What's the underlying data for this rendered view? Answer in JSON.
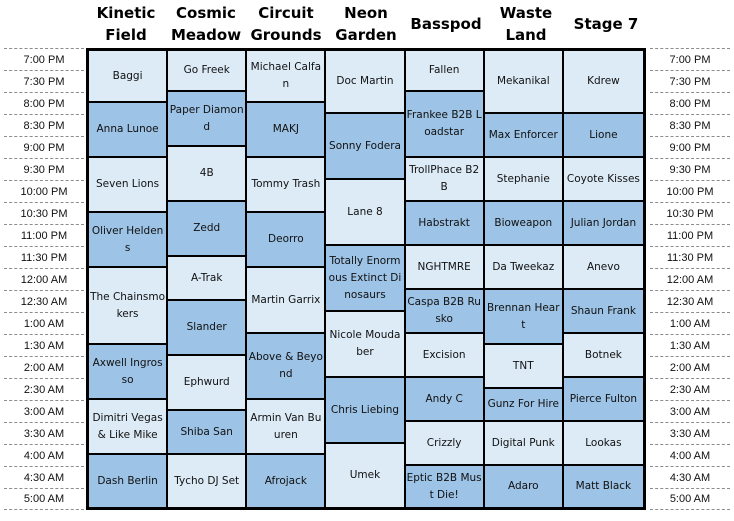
{
  "stages": [
    {
      "name": "Kinetic Field",
      "sets": [
        {
          "artist": "Baggi",
          "slots": 5,
          "shade": "light"
        },
        {
          "artist": "Anna Lunoe",
          "slots": 5,
          "shade": "dark"
        },
        {
          "artist": "Seven Lions",
          "slots": 5,
          "shade": "light"
        },
        {
          "artist": "Oliver Heldens",
          "slots": 5,
          "shade": "dark"
        },
        {
          "artist": "The Chainsmokers",
          "slots": 7,
          "shade": "light"
        },
        {
          "artist": "Axwell Ingrosso",
          "slots": 5,
          "shade": "dark"
        },
        {
          "artist": "Dimitri Vegas & Like Mike",
          "slots": 5,
          "shade": "light"
        },
        {
          "artist": "Dash Berlin",
          "slots": 5,
          "shade": "dark"
        }
      ]
    },
    {
      "name": "Cosmic Meadow",
      "sets": [
        {
          "artist": "Go Freek",
          "slots": 4,
          "shade": "light"
        },
        {
          "artist": "Paper Diamond",
          "slots": 5,
          "shade": "dark"
        },
        {
          "artist": "4B",
          "slots": 5,
          "shade": "light"
        },
        {
          "artist": "Zedd",
          "slots": 5,
          "shade": "dark"
        },
        {
          "artist": "A-Trak",
          "slots": 4,
          "shade": "light"
        },
        {
          "artist": "Slander",
          "slots": 5,
          "shade": "dark"
        },
        {
          "artist": "Ephwurd",
          "slots": 5,
          "shade": "light"
        },
        {
          "artist": "Shiba San",
          "slots": 4,
          "shade": "dark"
        },
        {
          "artist": "Tycho DJ Set",
          "slots": 5,
          "shade": "light"
        }
      ]
    },
    {
      "name": "Circuit Grounds",
      "sets": [
        {
          "artist": "Michael Calfan",
          "slots": 5,
          "shade": "light"
        },
        {
          "artist": "MAKJ",
          "slots": 5,
          "shade": "dark"
        },
        {
          "artist": "Tommy Trash",
          "slots": 5,
          "shade": "light"
        },
        {
          "artist": "Deorro",
          "slots": 5,
          "shade": "dark"
        },
        {
          "artist": "Martin Garrix",
          "slots": 6,
          "shade": "light"
        },
        {
          "artist": "Above & Beyond",
          "slots": 6,
          "shade": "dark"
        },
        {
          "artist": "Armin Van Buuren",
          "slots": 5,
          "shade": "light"
        },
        {
          "artist": "Afrojack",
          "slots": 5,
          "shade": "dark"
        }
      ]
    },
    {
      "name": "Neon Garden",
      "sets": [
        {
          "artist": "Doc Martin",
          "slots": 6,
          "shade": "light"
        },
        {
          "artist": "Sonny Fodera",
          "slots": 6,
          "shade": "dark"
        },
        {
          "artist": "Lane 8",
          "slots": 6,
          "shade": "light"
        },
        {
          "artist": "Totally Enormous Extinct Dinosaurs",
          "slots": 6,
          "shade": "dark"
        },
        {
          "artist": "Nicole Moudaber",
          "slots": 6,
          "shade": "light"
        },
        {
          "artist": "Chris Liebing",
          "slots": 6,
          "shade": "dark"
        },
        {
          "artist": "Umek",
          "slots": 6,
          "shade": "light"
        }
      ]
    },
    {
      "name": "Basspod",
      "sets": [
        {
          "artist": "Fallen",
          "slots": 4,
          "shade": "light"
        },
        {
          "artist": "Frankee B2B Loadstar",
          "slots": 6,
          "shade": "dark"
        },
        {
          "artist": "TrollPhace B2B",
          "slots": 4,
          "shade": "light"
        },
        {
          "artist": "Habstrakt",
          "slots": 4,
          "shade": "dark"
        },
        {
          "artist": "NGHTMRE",
          "slots": 4,
          "shade": "light"
        },
        {
          "artist": "Caspa B2B Rusko",
          "slots": 4,
          "shade": "dark"
        },
        {
          "artist": "Excision",
          "slots": 4,
          "shade": "light"
        },
        {
          "artist": "Andy C",
          "slots": 4,
          "shade": "dark"
        },
        {
          "artist": "Crizzly",
          "slots": 4,
          "shade": "light"
        },
        {
          "artist": "Eptic B2B Must Die!",
          "slots": 4,
          "shade": "dark"
        }
      ]
    },
    {
      "name": "Waste Land",
      "sets": [
        {
          "artist": "Mekanikal",
          "slots": 6,
          "shade": "light"
        },
        {
          "artist": "Max Enforcer",
          "slots": 4,
          "shade": "dark"
        },
        {
          "artist": "Stephanie",
          "slots": 4,
          "shade": "light"
        },
        {
          "artist": "Bioweapon",
          "slots": 4,
          "shade": "dark"
        },
        {
          "artist": "Da Tweekaz",
          "slots": 4,
          "shade": "light"
        },
        {
          "artist": "Brennan Heart",
          "slots": 5,
          "shade": "dark"
        },
        {
          "artist": "TNT",
          "slots": 4,
          "shade": "light"
        },
        {
          "artist": "Gunz For Hire",
          "slots": 3,
          "shade": "dark"
        },
        {
          "artist": "Digital Punk",
          "slots": 4,
          "shade": "light"
        },
        {
          "artist": "Adaro",
          "slots": 4,
          "shade": "dark"
        }
      ]
    },
    {
      "name": "Stage 7",
      "sets": [
        {
          "artist": "Kdrew",
          "slots": 6,
          "shade": "light"
        },
        {
          "artist": "Lione",
          "slots": 4,
          "shade": "dark"
        },
        {
          "artist": "Coyote Kisses",
          "slots": 4,
          "shade": "light"
        },
        {
          "artist": "Julian Jordan",
          "slots": 4,
          "shade": "dark"
        },
        {
          "artist": "Anevo",
          "slots": 4,
          "shade": "light"
        },
        {
          "artist": "Shaun Frank",
          "slots": 4,
          "shade": "dark"
        },
        {
          "artist": "Botnek",
          "slots": 4,
          "shade": "light"
        },
        {
          "artist": "Pierce Fulton",
          "slots": 4,
          "shade": "dark"
        },
        {
          "artist": "Lookas",
          "slots": 4,
          "shade": "light"
        },
        {
          "artist": "Matt Black",
          "slots": 4,
          "shade": "dark"
        }
      ]
    }
  ],
  "times": [
    "7:00 PM",
    "7:30 PM",
    "8:00 PM",
    "8:30 PM",
    "9:00 PM",
    "9:30 PM",
    "10:00 PM",
    "10:30 PM",
    "11:00 PM",
    "11:30 PM",
    "12:00 AM",
    "12:30 AM",
    "1:00 AM",
    "1:30 AM",
    "2:00 AM",
    "2:30 AM",
    "3:00 AM",
    "3:30 AM",
    "4:00 AM",
    "4:30 AM",
    "5:00 AM"
  ],
  "colors": {
    "light": "#ddebf7",
    "dark": "#9dc3e6",
    "border": "#000000"
  }
}
